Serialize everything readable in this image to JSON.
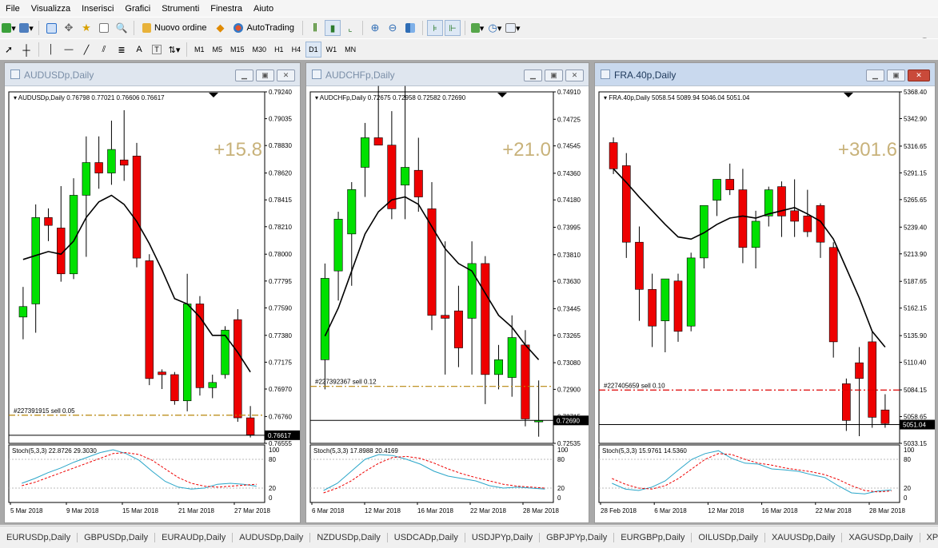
{
  "menu": [
    "File",
    "Visualizza",
    "Inserisci",
    "Grafici",
    "Strumenti",
    "Finestra",
    "Aiuto"
  ],
  "toolbar1": {
    "new_order": "Nuovo ordine",
    "auto_trading": "AutoTrading"
  },
  "timeframes": [
    "M1",
    "M5",
    "M15",
    "M30",
    "H1",
    "H4",
    "D1",
    "W1",
    "MN"
  ],
  "toolbar2_tools": [
    "A",
    "T"
  ],
  "charts": [
    {
      "title": "AUDUSDp,Daily",
      "header": "AUDUSDp,Daily  0.76798 0.77021 0.76606 0.76617",
      "pct": "+15.8",
      "yticks": [
        "0.79240",
        "0.79035",
        "0.78830",
        "0.78620",
        "0.78415",
        "0.78210",
        "0.78000",
        "0.77795",
        "0.77590",
        "0.77380",
        "0.77175",
        "0.76970",
        "0.76760",
        "0.76555"
      ],
      "ymin": 0.76555,
      "ymax": 0.7924,
      "price_tag": "0.76617",
      "order_label": "#227391915 sell 0.05",
      "order_price": 0.7677,
      "stoch": "Stoch(5,3,3) 22.8726 29.3030",
      "xlabels": [
        "5 Mar 2018",
        "9 Mar 2018",
        "15 Mar 2018",
        "21 Mar 2018",
        "27 Mar 2018"
      ],
      "candles": [
        [
          0.7752,
          0.7775,
          0.7735,
          0.776
        ],
        [
          0.7762,
          0.7838,
          0.774,
          0.7828
        ],
        [
          0.7828,
          0.7835,
          0.781,
          0.7822
        ],
        [
          0.782,
          0.7852,
          0.7779,
          0.7785
        ],
        [
          0.7785,
          0.7858,
          0.7781,
          0.7845
        ],
        [
          0.7845,
          0.789,
          0.7798,
          0.787
        ],
        [
          0.787,
          0.789,
          0.785,
          0.7862
        ],
        [
          0.7862,
          0.7902,
          0.7853,
          0.788
        ],
        [
          0.7872,
          0.791,
          0.7856,
          0.7868
        ],
        [
          0.7875,
          0.7885,
          0.779,
          0.7797
        ],
        [
          0.7795,
          0.78,
          0.77,
          0.7705
        ],
        [
          0.771,
          0.7712,
          0.7697,
          0.7708
        ],
        [
          0.7708,
          0.771,
          0.7685,
          0.7688
        ],
        [
          0.7688,
          0.7785,
          0.768,
          0.7762
        ],
        [
          0.7762,
          0.7768,
          0.7692,
          0.7698
        ],
        [
          0.7698,
          0.7708,
          0.769,
          0.7702
        ],
        [
          0.7708,
          0.7745,
          0.7705,
          0.7742
        ],
        [
          0.775,
          0.7758,
          0.7672,
          0.7675
        ],
        [
          0.7675,
          0.7684,
          0.766,
          0.7662
        ]
      ],
      "ma": [
        0.7796,
        0.7799,
        0.7802,
        0.78,
        0.781,
        0.7828,
        0.784,
        0.7845,
        0.7838,
        0.7825,
        0.7808,
        0.7788,
        0.7766,
        0.7762,
        0.7752,
        0.7738,
        0.7738,
        0.7725,
        0.771
      ],
      "stoch_main": [
        30,
        40,
        52,
        62,
        74,
        84,
        94,
        100,
        92,
        78,
        55,
        34,
        22,
        18,
        20,
        28,
        30,
        28,
        24
      ],
      "stoch_signal": [
        25,
        32,
        42,
        52,
        62,
        72,
        82,
        92,
        94,
        90,
        78,
        60,
        42,
        30,
        24,
        22,
        24,
        26,
        28
      ]
    },
    {
      "title": "AUDCHFp,Daily",
      "header": "AUDCHFp,Daily  0.72675 0.72958 0.72582 0.72690",
      "pct": "+21.0",
      "yticks": [
        "0.74910",
        "0.74725",
        "0.74545",
        "0.74360",
        "0.74180",
        "0.73995",
        "0.73810",
        "0.73630",
        "0.73445",
        "0.73265",
        "0.73080",
        "0.72900",
        "0.72715",
        "0.72535"
      ],
      "ymin": 0.72535,
      "ymax": 0.7491,
      "price_tag": "0.72690",
      "order_label": "#227392367 sell 0.12",
      "order_price": 0.7292,
      "stoch": "Stoch(5,3,3) 17.8988 20.4169",
      "xlabels": [
        "6 Mar 2018",
        "12 Mar 2018",
        "16 Mar 2018",
        "22 Mar 2018",
        "28 Mar 2018"
      ],
      "candles": [
        [
          0.731,
          0.7375,
          0.729,
          0.7365
        ],
        [
          0.737,
          0.741,
          0.735,
          0.7405
        ],
        [
          0.7395,
          0.743,
          0.736,
          0.7425
        ],
        [
          0.744,
          0.747,
          0.742,
          0.746
        ],
        [
          0.746,
          0.7495,
          0.7456,
          0.7455
        ],
        [
          0.7455,
          0.7478,
          0.7405,
          0.7412
        ],
        [
          0.7428,
          0.7495,
          0.7405,
          0.744
        ],
        [
          0.7438,
          0.746,
          0.741,
          0.742
        ],
        [
          0.7412,
          0.743,
          0.733,
          0.734
        ],
        [
          0.734,
          0.739,
          0.73,
          0.7338
        ],
        [
          0.7343,
          0.736,
          0.7305,
          0.7318
        ],
        [
          0.7338,
          0.739,
          0.73,
          0.7375
        ],
        [
          0.7375,
          0.738,
          0.728,
          0.73
        ],
        [
          0.73,
          0.732,
          0.729,
          0.731
        ],
        [
          0.7298,
          0.734,
          0.7285,
          0.7325
        ],
        [
          0.732,
          0.733,
          0.7265,
          0.727
        ],
        [
          0.7268,
          0.7296,
          0.7258,
          0.7269
        ]
      ],
      "ma": [
        0.7326,
        0.7345,
        0.737,
        0.7395,
        0.741,
        0.7418,
        0.742,
        0.7415,
        0.74,
        0.7385,
        0.7375,
        0.737,
        0.7355,
        0.734,
        0.7332,
        0.732,
        0.731
      ],
      "stoch_main": [
        15,
        30,
        55,
        80,
        90,
        88,
        80,
        70,
        55,
        45,
        40,
        35,
        25,
        20,
        22,
        20,
        18
      ],
      "stoch_signal": [
        10,
        20,
        35,
        55,
        72,
        84,
        86,
        82,
        72,
        60,
        50,
        42,
        35,
        28,
        24,
        22,
        20
      ]
    },
    {
      "title": "FRA.40p,Daily",
      "header": "FRA.40p,Daily  5058.54 5089.94 5046.04 5051.04",
      "pct": "+301.6",
      "yticks": [
        "5368.40",
        "5342.90",
        "5316.65",
        "5291.15",
        "5265.65",
        "5239.40",
        "5213.90",
        "5187.65",
        "5162.15",
        "5135.90",
        "5110.40",
        "5084.15",
        "5058.65",
        "5033.15"
      ],
      "ymin": 5033.15,
      "ymax": 5368.4,
      "price_tag": "5051.04",
      "order_label": "#227405659 sell 0.10",
      "order_price": 5084.0,
      "stoch": "Stoch(5,3,3) 15.9761 14.5360",
      "xlabels": [
        "28 Feb 2018",
        "6 Mar 2018",
        "12 Mar 2018",
        "16 Mar 2018",
        "22 Mar 2018",
        "28 Mar 2018"
      ],
      "candles": [
        [
          5320,
          5325,
          5290,
          5295
        ],
        [
          5298,
          5310,
          5210,
          5225
        ],
        [
          5225,
          5240,
          5150,
          5180
        ],
        [
          5180,
          5195,
          5125,
          5145
        ],
        [
          5150,
          5188,
          5120,
          5190
        ],
        [
          5188,
          5195,
          5130,
          5140
        ],
        [
          5145,
          5215,
          5140,
          5210
        ],
        [
          5210,
          5260,
          5200,
          5260
        ],
        [
          5265,
          5285,
          5250,
          5285
        ],
        [
          5285,
          5300,
          5270,
          5275
        ],
        [
          5275,
          5295,
          5205,
          5220
        ],
        [
          5220,
          5255,
          5200,
          5245
        ],
        [
          5250,
          5278,
          5240,
          5275
        ],
        [
          5278,
          5283,
          5230,
          5250
        ],
        [
          5255,
          5285,
          5230,
          5245
        ],
        [
          5250,
          5275,
          5230,
          5235
        ],
        [
          5260,
          5262,
          5210,
          5225
        ],
        [
          5220,
          5225,
          5115,
          5130
        ],
        [
          5090,
          5095,
          5045,
          5055
        ],
        [
          5110,
          5125,
          5040,
          5095
        ],
        [
          5130,
          5140,
          5048,
          5058
        ],
        [
          5065,
          5080,
          5048,
          5052
        ]
      ],
      "ma": [
        5295,
        5282,
        5268,
        5255,
        5242,
        5230,
        5228,
        5234,
        5242,
        5248,
        5250,
        5248,
        5252,
        5255,
        5258,
        5252,
        5245,
        5228,
        5200,
        5172,
        5140,
        5125
      ],
      "stoch_main": [
        30,
        18,
        15,
        22,
        35,
        58,
        80,
        92,
        98,
        82,
        72,
        70,
        60,
        58,
        55,
        48,
        42,
        25,
        10,
        8,
        14,
        16
      ],
      "stoch_signal": [
        40,
        28,
        20,
        18,
        25,
        40,
        60,
        80,
        92,
        90,
        80,
        72,
        68,
        62,
        58,
        54,
        48,
        38,
        25,
        15,
        12,
        14
      ]
    }
  ],
  "bottom_tabs": [
    "EURUSDp,Daily",
    "GBPUSDp,Daily",
    "EURAUDp,Daily",
    "AUDUSDp,Daily",
    "NZDUSDp,Daily",
    "USDCADp,Daily",
    "USDJPYp,Daily",
    "GBPJPYp,Daily",
    "EURGBPp,Daily",
    "OILUSDp,Daily",
    "XAUUSDp,Daily",
    "XAGUSDp,Daily",
    "XPDUSDp,Daily"
  ],
  "colors": {
    "bull": "#00e000",
    "bear": "#ee0000",
    "pct": "#c8b27a",
    "order": "#b8860b"
  }
}
